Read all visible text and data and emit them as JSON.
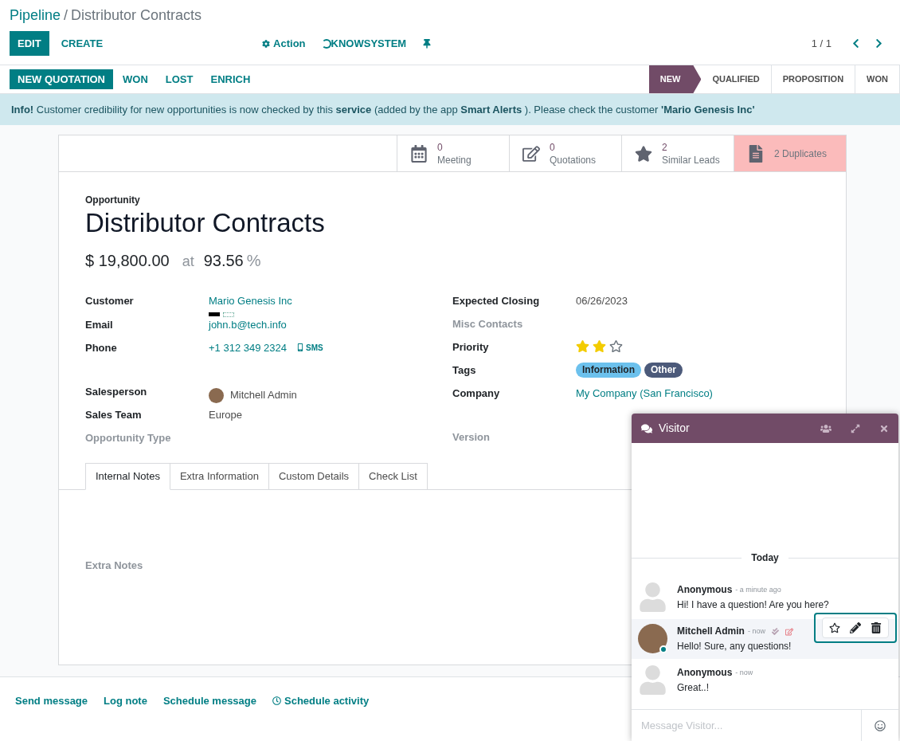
{
  "breadcrumb": {
    "parent": "Pipeline",
    "separator": "/",
    "current": "Distributor Contracts"
  },
  "control_panel": {
    "buttons": [
      "EDIT",
      "CREATE"
    ],
    "actions": [
      "Action",
      "KNOWSYSTEM"
    ],
    "pager": "1 / 1"
  },
  "statusbar": {
    "buttons": [
      {
        "label": "NEW QUOTATION",
        "primary": true
      },
      {
        "label": "WON",
        "primary": false
      },
      {
        "label": "LOST",
        "primary": false
      },
      {
        "label": "ENRICH",
        "primary": false
      }
    ],
    "stages": [
      {
        "label": "NEW",
        "selected": true
      },
      {
        "label": "QUALIFIED",
        "selected": false
      },
      {
        "label": "PROPOSITION",
        "selected": false
      },
      {
        "label": "WON",
        "selected": false
      }
    ]
  },
  "alert": "**Info!** Customer credibility for new opportunities is now checked by this **service** (added by the app **Smart Alerts** ). Please check the customer **'Mario Genesis Inc'**",
  "smart_buttons": [
    {
      "kind": "calendar",
      "count": "0",
      "label": "Meeting",
      "highlighted": false
    },
    {
      "kind": "edit",
      "count": "0",
      "label": "Quotations",
      "highlighted": false
    },
    {
      "kind": "star",
      "count": "2",
      "label": "Similar Leads",
      "highlighted": false
    },
    {
      "kind": "file",
      "label": "2 Duplicates",
      "highlighted": true
    }
  ],
  "form": {
    "type_label": "Opportunity",
    "title": "Distributor Contracts",
    "revenue": "$ 19,800.00",
    "at": "at",
    "probability": "93.56",
    "percent": "%",
    "left": [
      {
        "label": "Customer",
        "value": "Mario Genesis Inc",
        "kind": "link",
        "flags": true
      },
      {
        "label": "Email",
        "value": "john.b@tech.info",
        "kind": "link"
      },
      {
        "label": "Phone",
        "value": "+1 312 349 2324",
        "kind": "link",
        "sms": "SMS"
      },
      {
        "kind": "gap"
      },
      {
        "label": "Salesperson",
        "value": "Mitchell Admin",
        "kind": "user"
      },
      {
        "label": "Sales Team",
        "value": "Europe",
        "kind": "text"
      },
      {
        "label": "Opportunity Type",
        "kind": "empty"
      }
    ],
    "right": [
      {
        "label": "Expected Closing",
        "value": "06/26/2023",
        "kind": "text"
      },
      {
        "label": "Misc Contacts",
        "kind": "empty"
      },
      {
        "label": "Priority",
        "kind": "stars",
        "stars": 2
      },
      {
        "label": "Tags",
        "kind": "tags",
        "tags": [
          {
            "label": "Information",
            "color": "#6cc1ed"
          },
          {
            "label": "Other",
            "color": "#4c5a7a"
          }
        ]
      },
      {
        "label": "Company",
        "value": "My Company (San Francisco)",
        "kind": "link"
      },
      {
        "kind": "gap"
      },
      {
        "label": "Version",
        "kind": "empty"
      }
    ],
    "tabs": [
      {
        "label": "Internal Notes",
        "selected": true
      },
      {
        "label": "Extra Information",
        "selected": false
      },
      {
        "label": "Custom Details",
        "selected": false
      },
      {
        "label": "Check List",
        "selected": false
      }
    ],
    "notes_label": "Extra Notes"
  },
  "chatter": [
    "Send message",
    "Log note",
    "Schedule message",
    "Schedule activity"
  ],
  "chat": {
    "title": "Visitor",
    "day": "Today",
    "messages": [
      {
        "author": "Anonymous",
        "time": "- a minute ago",
        "text": "Hi! I have a question! Are you here?",
        "kind": "visitor",
        "hovered": false
      },
      {
        "author": "Mitchell Admin",
        "time": "- now",
        "text": "Hello! Sure, any questions!",
        "kind": "agent",
        "hovered": true
      },
      {
        "author": "Anonymous",
        "time": "- now",
        "text": "Great..!",
        "kind": "visitor",
        "hovered": false
      }
    ],
    "placeholder": "Message Visitor..."
  }
}
